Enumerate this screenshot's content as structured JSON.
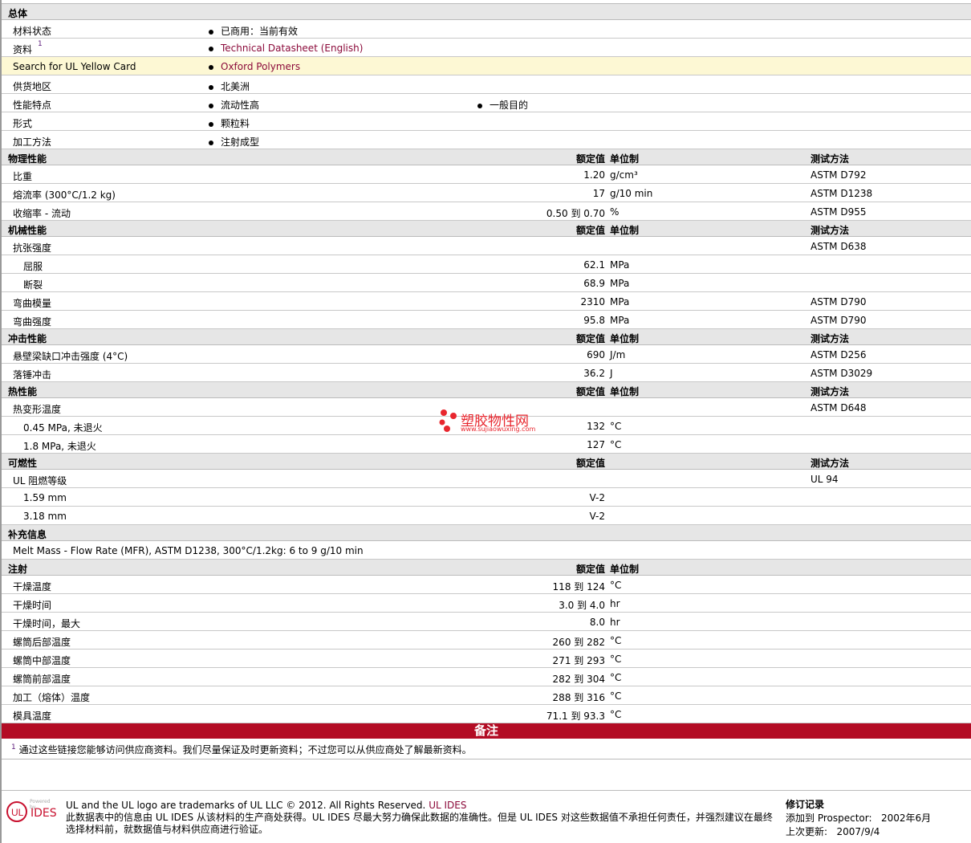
{
  "general": {
    "title": "总体",
    "rows": [
      {
        "label": "材料状态",
        "items": [
          {
            "text": "已商用：当前有效"
          }
        ]
      },
      {
        "label": "资料",
        "sup": "1",
        "items": [
          {
            "text": "Technical Datasheet (English)",
            "link": true
          }
        ]
      },
      {
        "label": "Search for UL Yellow Card",
        "highlight": true,
        "items": [
          {
            "text": "Oxford Polymers",
            "link": true
          }
        ]
      },
      {
        "label": "供货地区",
        "items": [
          {
            "text": "北美洲"
          }
        ]
      },
      {
        "label": "性能特点",
        "items": [
          {
            "text": "流动性高"
          },
          {
            "text": "一般目的"
          }
        ]
      },
      {
        "label": "形式",
        "items": [
          {
            "text": "颗粒料"
          }
        ]
      },
      {
        "label": "加工方法",
        "items": [
          {
            "text": "注射成型"
          }
        ]
      }
    ]
  },
  "sections": [
    {
      "title": "物理性能",
      "value_header": "额定值",
      "unit_header": "单位制",
      "method_header": "测试方法",
      "rows": [
        {
          "label": "比重",
          "value": "1.20",
          "unit": "g/cm³",
          "method": "ASTM D792"
        },
        {
          "label": "熔流率  (300°C/1.2 kg)",
          "value": "17",
          "unit": "g/10 min",
          "method": "ASTM D1238"
        },
        {
          "label": "收缩率  - 流动",
          "value": "0.50 到  0.70",
          "unit": "%",
          "method": "ASTM D955"
        }
      ]
    },
    {
      "title": "机械性能",
      "value_header": "额定值",
      "unit_header": "单位制",
      "method_header": "测试方法",
      "rows": [
        {
          "label": "抗张强度",
          "method": "ASTM D638"
        },
        {
          "label": "屈服",
          "indent": true,
          "value": "62.1",
          "unit": "MPa"
        },
        {
          "label": "断裂",
          "indent": true,
          "value": "68.9",
          "unit": "MPa"
        },
        {
          "label": "弯曲模量",
          "value": "2310",
          "unit": "MPa",
          "method": "ASTM D790"
        },
        {
          "label": "弯曲强度",
          "value": "95.8",
          "unit": "MPa",
          "method": "ASTM D790"
        }
      ]
    },
    {
      "title": "冲击性能",
      "value_header": "额定值",
      "unit_header": "单位制",
      "method_header": "测试方法",
      "rows": [
        {
          "label": "悬壁梁缺口冲击强度  (4°C)",
          "value": "690",
          "unit": "J/m",
          "method": "ASTM D256"
        },
        {
          "label": "落锤冲击",
          "value": "36.2",
          "unit": "J",
          "method": "ASTM D3029"
        }
      ]
    },
    {
      "title": "热性能",
      "value_header": "额定值",
      "unit_header": "单位制",
      "method_header": "测试方法",
      "rows": [
        {
          "label": "热变形温度",
          "method": "ASTM D648"
        },
        {
          "label": "0.45 MPa, 未退火",
          "indent": true,
          "value": "132",
          "unit": "°C"
        },
        {
          "label": "1.8 MPa, 未退火",
          "indent": true,
          "value": "127",
          "unit": "°C"
        }
      ]
    },
    {
      "title": "可燃性",
      "value_header": "额定值",
      "method_header": "测试方法",
      "rows": [
        {
          "label": "UL 阻燃等级",
          "method": "UL 94"
        },
        {
          "label": "1.59 mm",
          "indent": true,
          "value": "V-2"
        },
        {
          "label": "3.18 mm",
          "indent": true,
          "value": "V-2"
        }
      ]
    },
    {
      "title": "补充信息",
      "rows": [
        {
          "label": "Melt Mass - Flow Rate (MFR), ASTM D1238, 300°C/1.2kg: 6 to 9 g/10 min"
        }
      ]
    },
    {
      "title": "注射",
      "value_header": "额定值",
      "unit_header": "单位制",
      "rows": [
        {
          "label": "干燥温度",
          "value": "118 到  124",
          "unit": "°C"
        },
        {
          "label": "干燥时间",
          "value": "3.0 到  4.0",
          "unit": "hr"
        },
        {
          "label": "干燥时间，最大",
          "value": "8.0",
          "unit": "hr"
        },
        {
          "label": "螺筒后部温度",
          "value": "260 到  282",
          "unit": "°C"
        },
        {
          "label": "螺筒中部温度",
          "value": "271 到  293",
          "unit": "°C"
        },
        {
          "label": "螺筒前部温度",
          "value": "282 到  304",
          "unit": "°C"
        },
        {
          "label": "加工（熔体）温度",
          "value": "288 到  316",
          "unit": "°C"
        },
        {
          "label": "模具温度",
          "value": "71.1 到  93.3",
          "unit": "°C"
        }
      ]
    }
  ],
  "notes": {
    "title": "备注",
    "sup": "1",
    "text": "通过这些链接您能够访问供应商资料。我们尽量保证及时更新资料；不过您可以从供应商处了解最新资料。"
  },
  "footer": {
    "logo_powered": "Powered by",
    "logo_text": "IDES",
    "trademark": "UL and the UL logo are trademarks of UL LLC © 2012. All Rights Reserved.",
    "trademark_link": "UL IDES",
    "disclaimer": "此数据表中的信息由  UL IDES 从该材料的生产商处获得。UL IDES 尽最大努力确保此数据的准确性。但是  UL IDES 对这些数据值不承担任何责任，并强烈建议在最终选择材料前，就数据值与材料供应商进行验证。",
    "revision_title": "修订记录",
    "added_label": "添加到  Prospector:",
    "added_value": "2002年6月",
    "updated_label": "上次更新:",
    "updated_value": "2007/9/4"
  },
  "watermark": {
    "name": "塑胶物性网",
    "url": "www.sujiaowuxing.com"
  },
  "colors": {
    "accent": "#b30c24",
    "link": "#8b0a3a",
    "highlight": "#fdf8d4"
  }
}
